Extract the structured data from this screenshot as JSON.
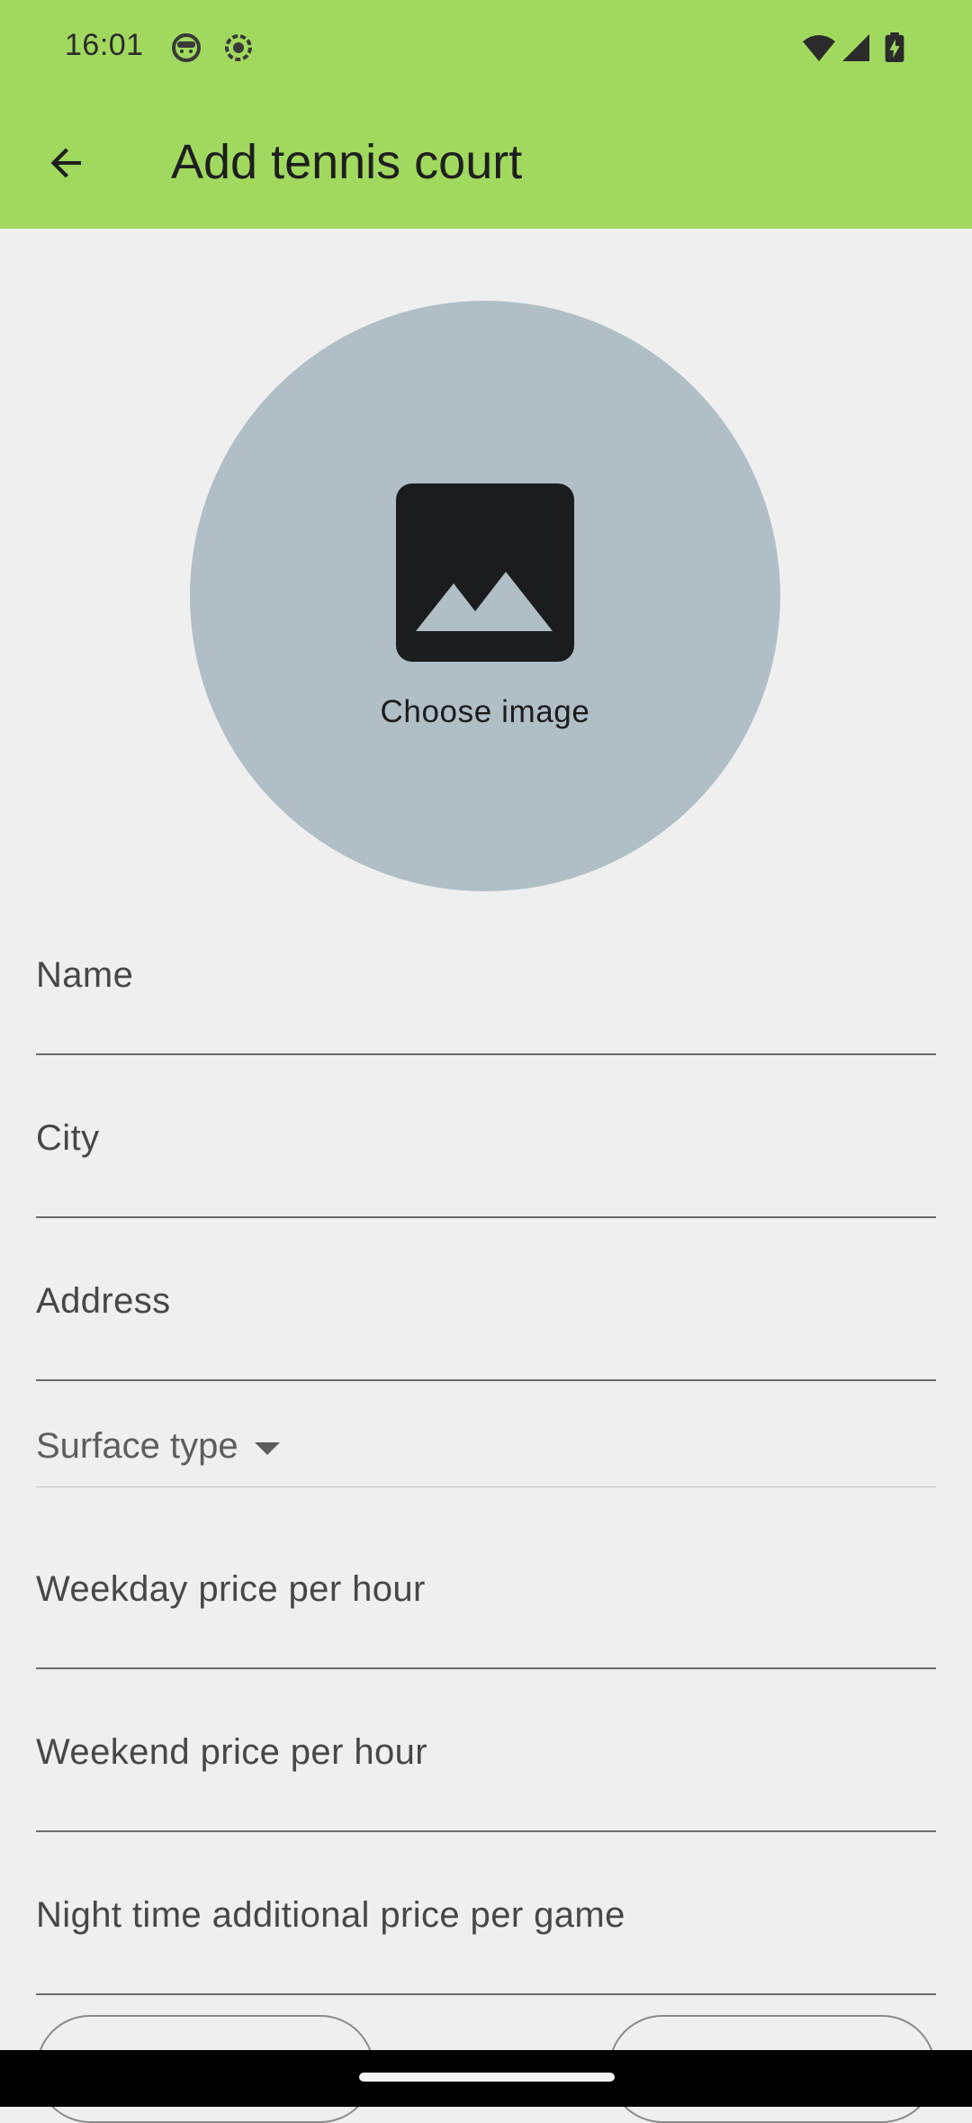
{
  "status_bar": {
    "time": "16:01",
    "icons": [
      "face-icon",
      "record-icon",
      "wifi-icon",
      "signal-icon",
      "battery-icon"
    ]
  },
  "app_bar": {
    "back_icon": "arrow-back-icon",
    "title": "Add tennis court"
  },
  "image_picker": {
    "icon": "image-icon",
    "label": "Choose image"
  },
  "form": {
    "name_label": "Name",
    "city_label": "City",
    "address_label": "Address",
    "surface_type_label": "Surface type",
    "weekday_price_label": "Weekday price per hour",
    "weekend_price_label": "Weekend price per hour",
    "night_price_label": "Night time additional price per game"
  },
  "colors": {
    "app_bar": "#a1d95f",
    "background": "#efefef",
    "image_circle": "#b0bec5",
    "icon_dark": "#1a1c1e"
  }
}
